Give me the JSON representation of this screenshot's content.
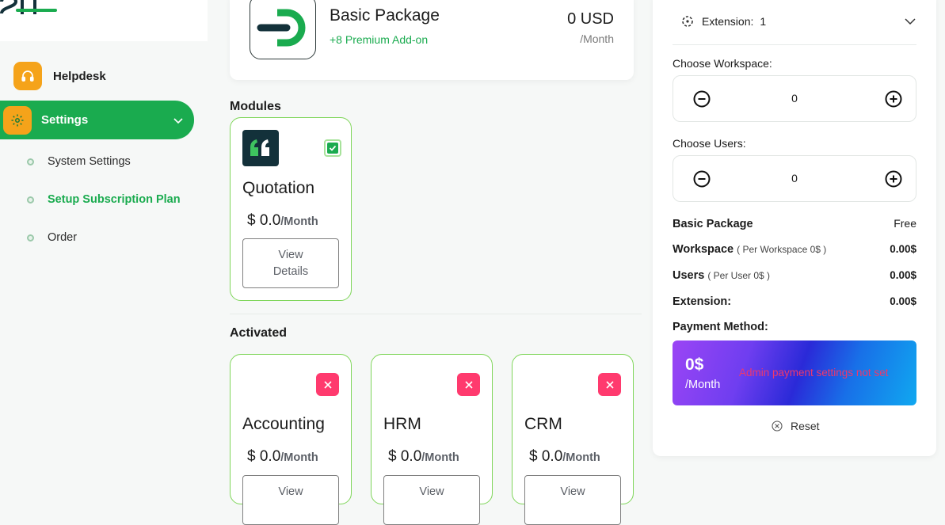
{
  "sidebar": {
    "items": [
      {
        "label": "Helpdesk",
        "icon": "headset-icon"
      },
      {
        "label": "Settings",
        "icon": "gear-icon",
        "active": true
      }
    ],
    "subitems": [
      {
        "label": "System Settings"
      },
      {
        "label": "Setup Subscription Plan",
        "active": true
      },
      {
        "label": "Order"
      }
    ]
  },
  "package": {
    "name": "Basic Package",
    "addon": "+8 Premium Add-on",
    "price": "0 USD",
    "period": "/Month"
  },
  "modules": {
    "title": "Modules",
    "items": [
      {
        "name": "Quotation",
        "price": "$ 0.0",
        "unit": "/Month",
        "button": "View Details",
        "checked": true
      }
    ]
  },
  "activated": {
    "title": "Activated",
    "items": [
      {
        "name": "Accounting",
        "price": "$ 0.0",
        "unit": "/Month",
        "button": "View"
      },
      {
        "name": "HRM",
        "price": "$ 0.0",
        "unit": "/Month",
        "button": "View"
      },
      {
        "name": "CRM",
        "price": "$ 0.0",
        "unit": "/Month",
        "button": "View"
      }
    ]
  },
  "panel": {
    "extension_label": "Extension:",
    "extension_value": "1",
    "workspace_label": "Choose Workspace:",
    "workspace_value": "0",
    "users_label": "Choose Users:",
    "users_value": "0",
    "summary": [
      {
        "key": "Basic Package",
        "note": "",
        "value": "Free"
      },
      {
        "key": "Workspace",
        "note": "( Per Workspace 0$ )",
        "value": "0.00$"
      },
      {
        "key": "Users",
        "note": "( Per User 0$ )",
        "value": "0.00$"
      },
      {
        "key": "Extension:",
        "note": "",
        "value": "0.00$"
      }
    ],
    "payment_label": "Payment Method:",
    "payment_amount": "0$",
    "payment_period": "/Month",
    "payment_warning": "Admin payment settings not set",
    "reset_label": "Reset"
  },
  "colors": {
    "accent": "#1aab4f",
    "orange": "#f5a31a",
    "danger": "#ff3a6e",
    "warning_text": "#f0386b"
  }
}
